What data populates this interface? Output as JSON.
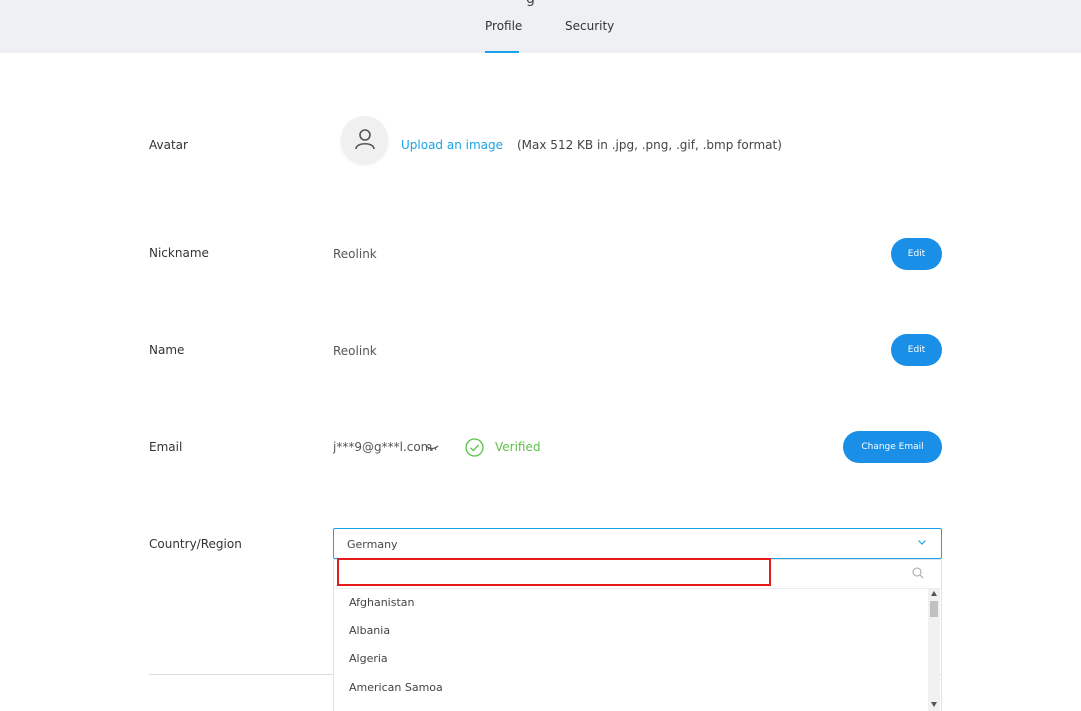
{
  "header": {
    "partial_title": "g",
    "tabs": [
      {
        "label": "Profile",
        "active": true
      },
      {
        "label": "Security",
        "active": false
      }
    ]
  },
  "avatar": {
    "label": "Avatar",
    "upload_link": "Upload an image",
    "hint": "(Max 512 KB in .jpg, .png, .gif, .bmp format)"
  },
  "nickname": {
    "label": "Nickname",
    "value": "Reolink",
    "button": "Edit"
  },
  "name": {
    "label": "Name",
    "value": "Reolink",
    "button": "Edit"
  },
  "email": {
    "label": "Email",
    "value": "j***9@g***l.com",
    "status": "Verified",
    "button": "Change Email"
  },
  "country": {
    "label": "Country/Region",
    "selected": "Germany",
    "search_value": "",
    "options": [
      "Afghanistan",
      "Albania",
      "Algeria",
      "American Samoa"
    ]
  },
  "colors": {
    "accent": "#1aa3e8",
    "button": "#1a8fe8",
    "verified": "#5cc24a",
    "highlight": "#e31b1b"
  },
  "icons": [
    "user-icon",
    "eye-closed-icon",
    "check-circle-icon",
    "chevron-down-icon",
    "search-icon"
  ]
}
